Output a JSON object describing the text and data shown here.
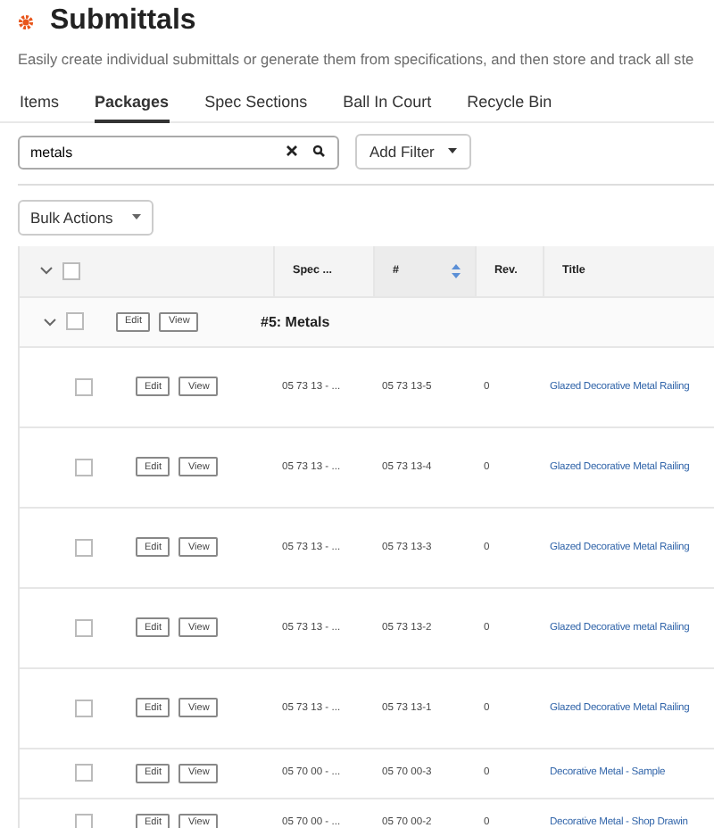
{
  "page": {
    "title": "Submittals",
    "subtitle": "Easily create individual submittals or generate them from specifications, and then store and track all ste"
  },
  "tabs": [
    {
      "label": "Items",
      "selected": false
    },
    {
      "label": "Packages",
      "selected": true
    },
    {
      "label": "Spec Sections",
      "selected": false
    },
    {
      "label": "Ball In Court",
      "selected": false
    },
    {
      "label": "Recycle Bin",
      "selected": false
    }
  ],
  "search": {
    "value": "metals"
  },
  "filter_button": "Add Filter",
  "bulk_actions": "Bulk Actions",
  "table": {
    "header": {
      "expanded": true,
      "checked": false
    },
    "columns": [
      {
        "label": "Spec ...",
        "sorted": false
      },
      {
        "label": "#",
        "sorted": true
      },
      {
        "label": "Rev.",
        "sorted": false
      },
      {
        "label": "Title",
        "sorted": false
      }
    ],
    "group": {
      "label": "#5: Metals",
      "expanded": true,
      "checked": false,
      "edit": "Edit",
      "view": "View"
    },
    "rows": [
      {
        "checked": false,
        "edit": "Edit",
        "view": "View",
        "spec": "05 73 13 - ...",
        "number": "05 73 13-5",
        "rev": "0",
        "title": "Glazed Decorative Metal Railing"
      },
      {
        "checked": false,
        "edit": "Edit",
        "view": "View",
        "spec": "05 73 13 - ...",
        "number": "05 73 13-4",
        "rev": "0",
        "title": "Glazed Decorative Metal Railing"
      },
      {
        "checked": false,
        "edit": "Edit",
        "view": "View",
        "spec": "05 73 13 - ...",
        "number": "05 73 13-3",
        "rev": "0",
        "title": "Glazed Decorative Metal Railing"
      },
      {
        "checked": false,
        "edit": "Edit",
        "view": "View",
        "spec": "05 73 13 - ...",
        "number": "05 73 13-2",
        "rev": "0",
        "title": "Glazed Decorative metal Railing"
      },
      {
        "checked": false,
        "edit": "Edit",
        "view": "View",
        "spec": "05 73 13 - ...",
        "number": "05 73 13-1",
        "rev": "0",
        "title": "Glazed Decorative Metal Railing"
      },
      {
        "checked": false,
        "edit": "Edit",
        "view": "View",
        "spec": "05 70 00 - ...",
        "number": "05 70 00-3",
        "rev": "0",
        "title": "Decorative Metal - Sample"
      },
      {
        "checked": false,
        "edit": "Edit",
        "view": "View",
        "spec": "05 70 00 - ...",
        "number": "05 70 00-2",
        "rev": "0",
        "title": "Decorative Metal - Shop Drawin"
      }
    ]
  }
}
